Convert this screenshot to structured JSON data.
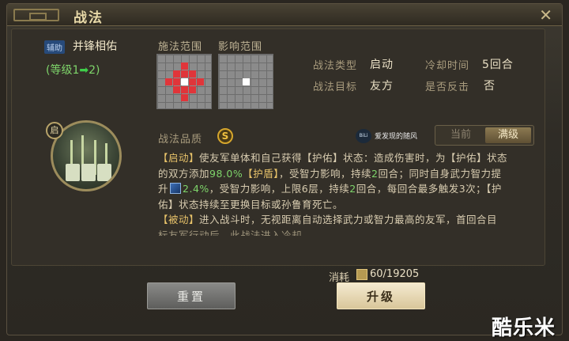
{
  "window": {
    "title": "战法"
  },
  "skill": {
    "tag": "辅助",
    "name": "并锋相佑",
    "level_text": "(等级1",
    "level_arrow": "➡",
    "level_target": "2)",
    "start_badge": "启"
  },
  "ranges": {
    "cast_label": "施法范围",
    "effect_label": "影响范围"
  },
  "attributes": {
    "type_label": "战法类型",
    "type_value": "启动",
    "cooldown_label": "冷却时间",
    "cooldown_value": "5回合",
    "target_label": "战法目标",
    "target_value": "友方",
    "counter_label": "是否反击",
    "counter_value": "否",
    "quality_label": "战法品质",
    "quality_value": "S"
  },
  "watermark": {
    "logo": "BiLi",
    "text": "爱发现的随风"
  },
  "level_toggle": {
    "current": "当前",
    "max": "满级",
    "selected": "满级"
  },
  "description": {
    "l1_a": "【启动】",
    "l1_b": "使友军单体和自己获得【护佑】状态：造成伤害时，为【护佑】状态",
    "l2_a": "的双方添加",
    "l2_num": "98.0%",
    "l2_b": "【护盾】",
    "l2_c": "，受智力影响，持续",
    "l2_num2": "2",
    "l2_d": "回合；同时自身武力智力提",
    "l3_a": "升",
    "l3_num": "2.4%",
    "l3_b": "，受智力影响，上限6层，持续",
    "l3_num2": "2",
    "l3_c": "回合，每回合最多触发3次；【护",
    "l4": "佑】状态持续至更换目标或孙鲁育死亡。",
    "l5_a": "【被动】",
    "l5_b": "进入战斗时，无视距离自动选择武力或智力最高的友军，首回合目",
    "l6": "标友军行动后，此战法进入冷却"
  },
  "cost": {
    "label": "消耗",
    "value": "60/19205"
  },
  "buttons": {
    "reset": "重置",
    "upgrade": "升级"
  },
  "footer": {
    "brand": "酷乐米"
  },
  "colors": {
    "accent_gold": "#e8c36a",
    "value_green": "#7ed46a",
    "cast_red": "#e0353a"
  }
}
